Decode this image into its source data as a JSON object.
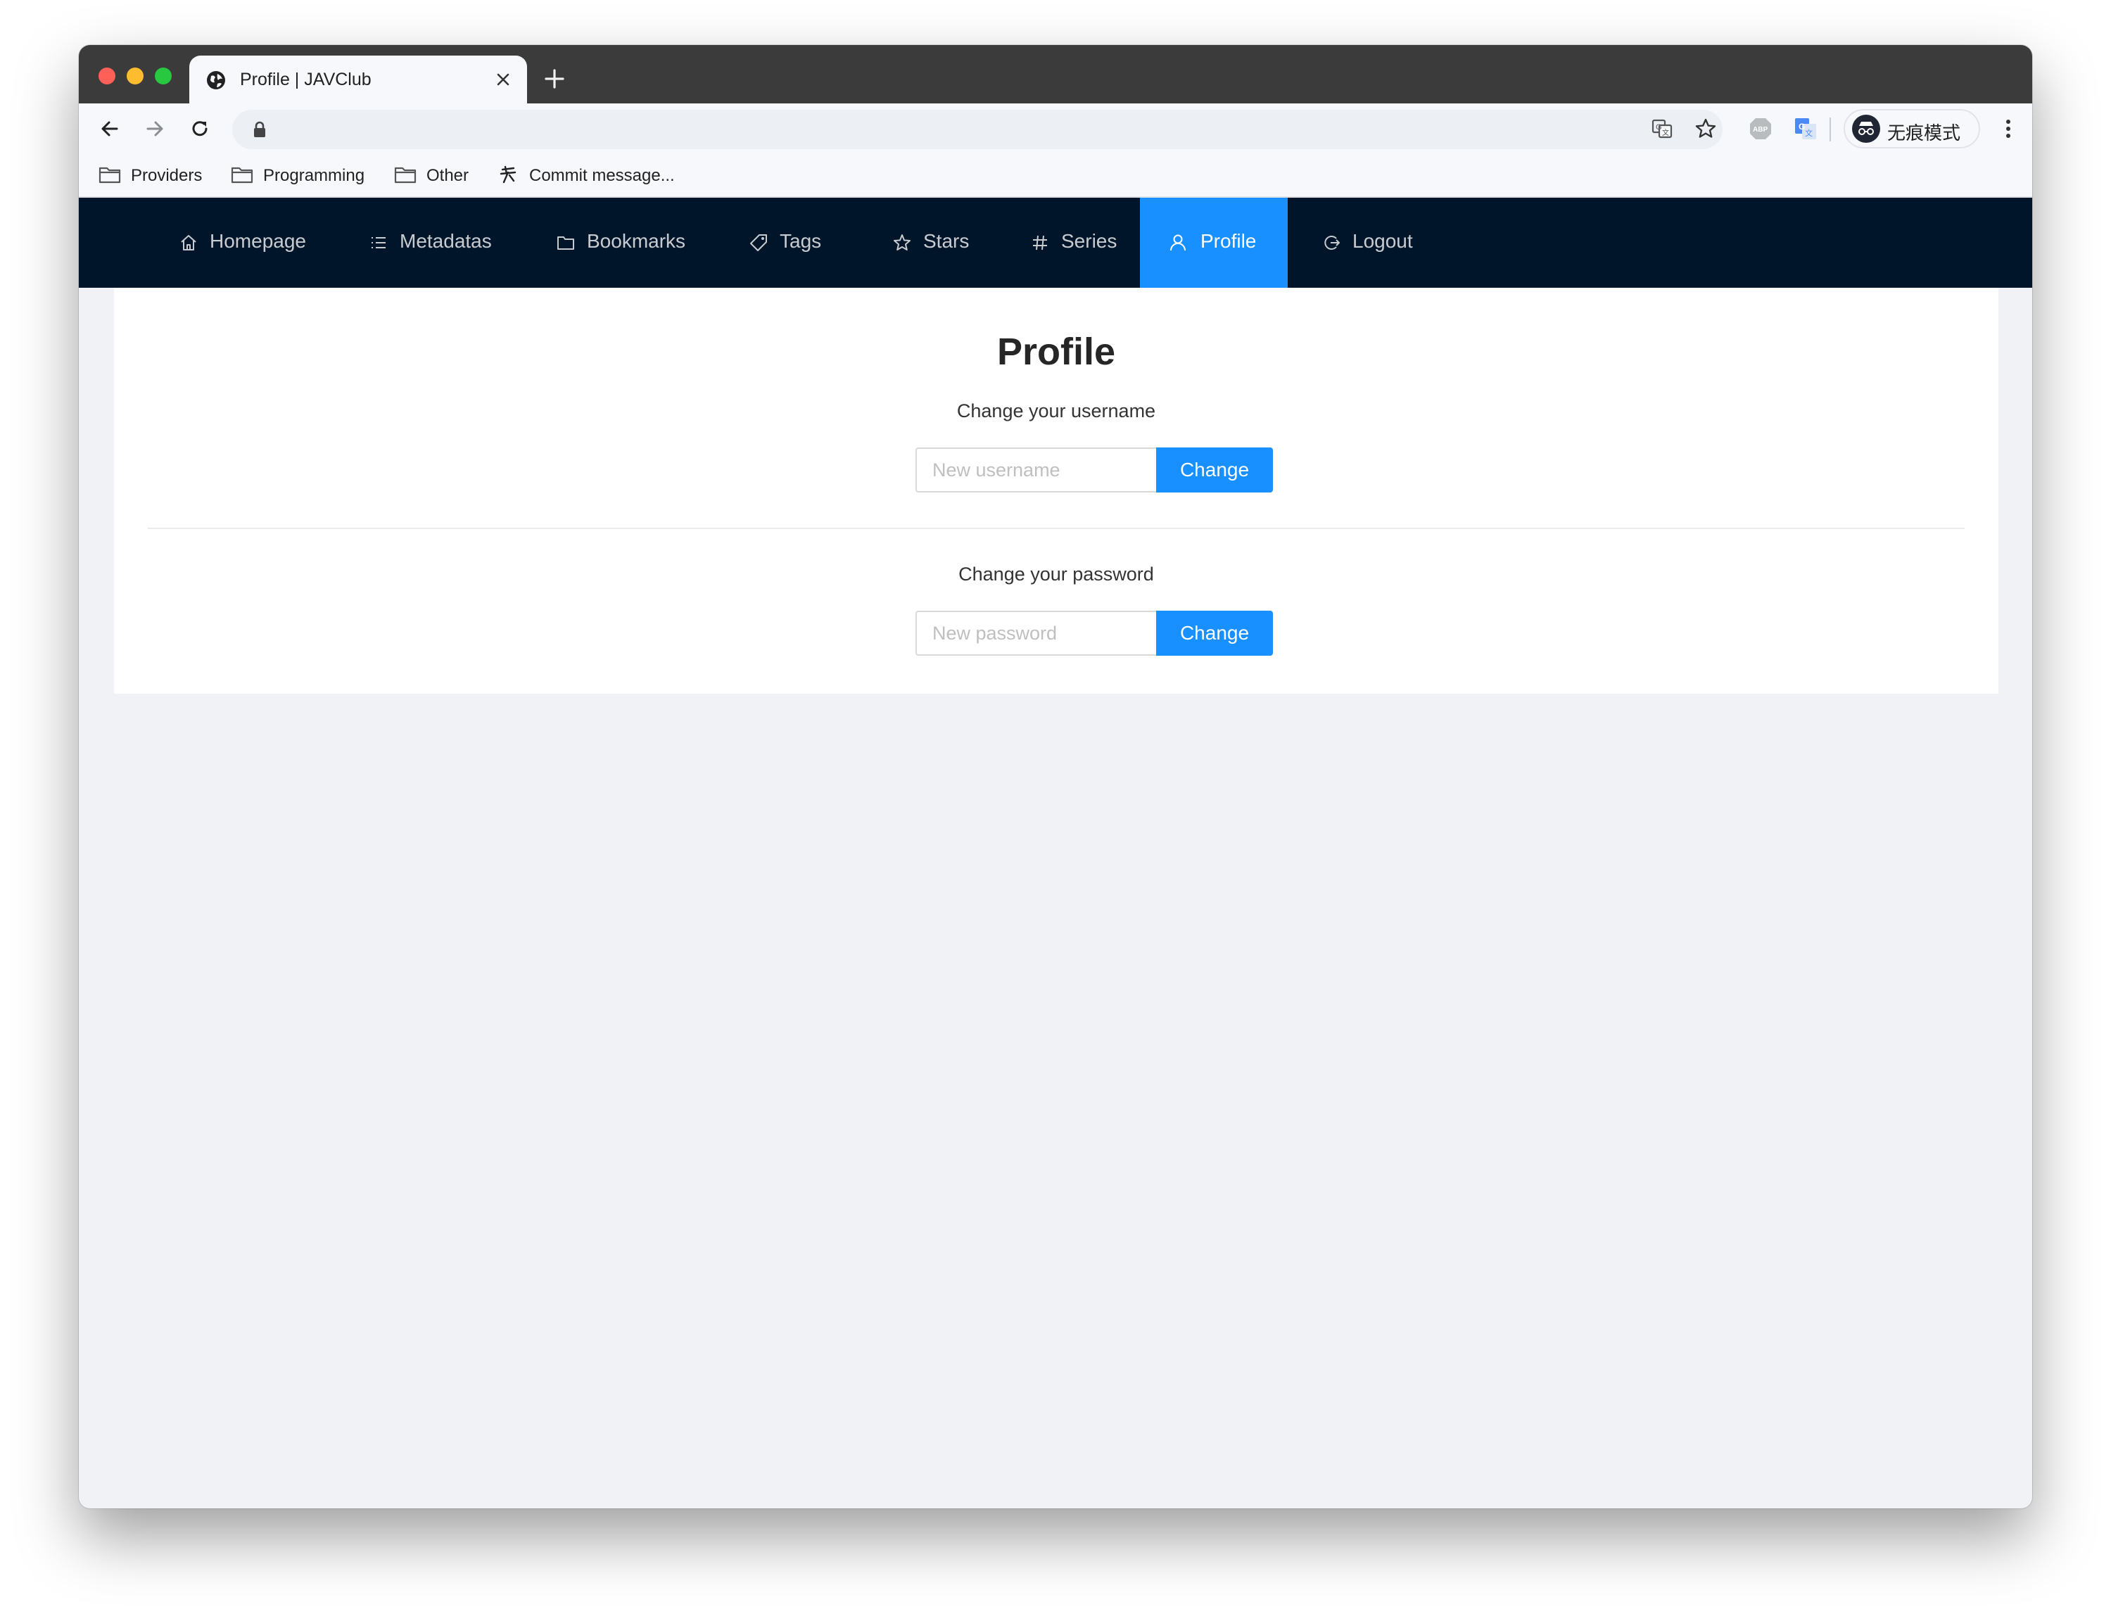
{
  "browser": {
    "tab_title": "Profile | JAVClub",
    "address": "",
    "profile_label": "无痕模式"
  },
  "bookmarks": [
    {
      "label": "Providers"
    },
    {
      "label": "Programming"
    },
    {
      "label": "Other"
    },
    {
      "label": "Commit message..."
    }
  ],
  "nav": {
    "items": [
      {
        "label": "Homepage",
        "icon": "home-icon"
      },
      {
        "label": "Metadatas",
        "icon": "list-icon"
      },
      {
        "label": "Bookmarks",
        "icon": "folder-icon"
      },
      {
        "label": "Tags",
        "icon": "tag-icon"
      },
      {
        "label": "Stars",
        "icon": "star-icon"
      },
      {
        "label": "Series",
        "icon": "hash-icon"
      },
      {
        "label": "Profile",
        "icon": "user-icon",
        "active": true
      },
      {
        "label": "Logout",
        "icon": "logout-icon"
      }
    ],
    "active_color": "#1890ff",
    "background_color": "#001529"
  },
  "page": {
    "title": "Profile",
    "username_section": {
      "label": "Change your username",
      "placeholder": "New username",
      "button": "Change"
    },
    "password_section": {
      "label": "Change your password",
      "placeholder": "New password",
      "button": "Change"
    }
  }
}
